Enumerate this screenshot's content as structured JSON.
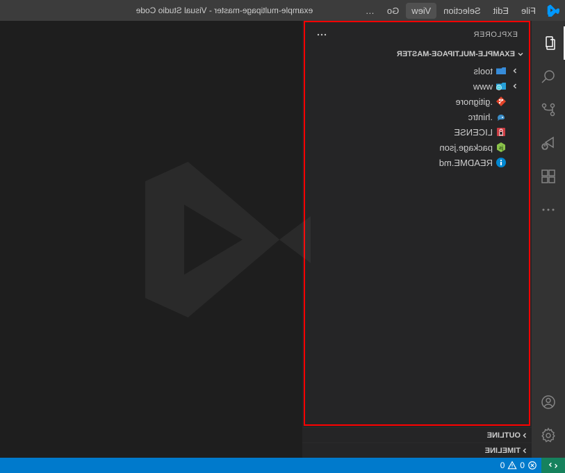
{
  "title": "example-multipage-master - Visual Studio Code",
  "menu": {
    "file": "File",
    "edit": "Edit",
    "selection": "Selection",
    "view": "View",
    "go": "Go",
    "more": "…"
  },
  "explorer": {
    "title": "Explorer",
    "project": "EXAMPLE-MULTIPAGE-MASTER",
    "items": [
      {
        "type": "folder",
        "name": "tools",
        "icon": "folder-tools",
        "color": "#378cda"
      },
      {
        "type": "folder",
        "name": "www",
        "icon": "folder-www",
        "color": "#269fd8"
      },
      {
        "type": "file",
        "name": ".gitignore",
        "icon": "git",
        "color": "#e24329"
      },
      {
        "type": "file",
        "name": ".hintrc",
        "icon": "hint",
        "color": "#3c8fc9"
      },
      {
        "type": "file",
        "name": "LICENSE",
        "icon": "license",
        "color": "#cc3e44"
      },
      {
        "type": "file",
        "name": "package.json",
        "icon": "npm",
        "color": "#8bc34a"
      },
      {
        "type": "file",
        "name": "README.md",
        "icon": "info",
        "color": "#0288d1"
      }
    ],
    "outline": "Outline",
    "timeline": "Timeline"
  },
  "status": {
    "errors": "0",
    "warnings": "0"
  }
}
